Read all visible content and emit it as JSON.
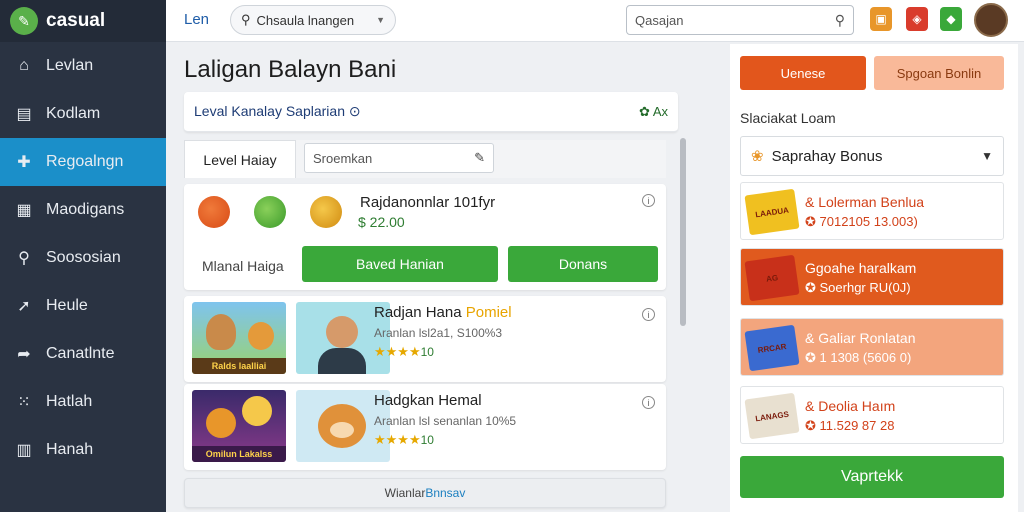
{
  "app": {
    "brand": "casual",
    "logo_glyph": "✎"
  },
  "sidebar": {
    "items": [
      {
        "label": "Levlan",
        "icon": "home-icon",
        "glyph": "⌂",
        "active": false
      },
      {
        "label": "Kodlam",
        "icon": "monitor-icon",
        "glyph": "▤",
        "active": false
      },
      {
        "label": "Regoalngn",
        "icon": "puzzle-icon",
        "glyph": "✚",
        "active": true
      },
      {
        "label": "Maodigans",
        "icon": "dashboard-icon",
        "glyph": "▦",
        "active": false
      },
      {
        "label": "Soososian",
        "icon": "search-icon",
        "glyph": "⚲",
        "active": false
      },
      {
        "label": "Heule",
        "icon": "pin-icon",
        "glyph": "➚",
        "active": false
      },
      {
        "label": "Canatlnte",
        "icon": "share-icon",
        "glyph": "➦",
        "active": false
      },
      {
        "label": "Hatlah",
        "icon": "grid-icon",
        "glyph": "⁙",
        "active": false
      },
      {
        "label": "Hanah",
        "icon": "book-icon",
        "glyph": "▥",
        "active": false
      }
    ]
  },
  "topbar": {
    "lang": "Len",
    "select_label": "Chsaula lnangen",
    "search_placeholder": "Qasajan",
    "icons": [
      {
        "name": "store-icon",
        "color": "#e8962a",
        "glyph": "▣"
      },
      {
        "name": "shield-icon",
        "color": "#d93c2c",
        "glyph": "◈"
      },
      {
        "name": "android-icon",
        "color": "#3aa83a",
        "glyph": "◆"
      }
    ]
  },
  "main": {
    "title": "Laligan Balayn Bani",
    "section": {
      "title": "Leval Kanalay Saplarian ⊙",
      "right": "✿ Ax"
    },
    "tab": {
      "active": "Level Haiay",
      "input_placeholder": "Sroemkan"
    },
    "featured": {
      "title": "Rajdanonnlar 101fyr",
      "price": "$ 22.00",
      "label": "Mlanal Haiga",
      "btn1": "Baved Hanian",
      "btn2": "Donans"
    },
    "games": [
      {
        "title": "Radjan Hana",
        "title_hl": "Pomiel",
        "sub": "Aranlan lsl2a1, S100%3",
        "stars": "★★★★",
        "rating": "10",
        "thumb_caption": "Ralds laalliai"
      },
      {
        "title": "Hadgkan Hemal",
        "title_hl": "",
        "sub": "Aranlan lsl senanlan 10%5",
        "stars": "★★★★",
        "rating": "10",
        "thumb_caption": "Omilun Lakalss"
      }
    ],
    "footer": {
      "text": "Wianlar ",
      "hl": "Bnnsav"
    }
  },
  "right": {
    "btn_primary": "Uenese",
    "btn_secondary": "Spgoan Bonlin",
    "label": "Slaciakat Loam",
    "select_value": "Saprahay Bonus",
    "offers": [
      {
        "title": "& Lolerman Benlua",
        "sub": "✪ 7012105 13.003)",
        "bg": "#ffffff",
        "title_color": "#d2421a",
        "sub_color": "#d2421a",
        "img_text": "LAADUA"
      },
      {
        "title": "Ggoahe haralkam",
        "sub": "✪ Soerhgr RU(0J)",
        "bg": "#e05a1e",
        "title_color": "#ffffff",
        "sub_color": "#ffffff",
        "img_text": "AG"
      },
      {
        "title": "& Galiar Ronlatan",
        "sub": "✪ 1 1308 (5606 0)",
        "bg": "#f3a57d",
        "title_color": "#ffffff",
        "sub_color": "#ffffff",
        "img_text": "RRCAR"
      },
      {
        "title": "& Deolia Haım",
        "sub": "✪ 11.529 87 28",
        "bg": "#ffffff",
        "title_color": "#d2421a",
        "sub_color": "#d2421a",
        "img_text": "LANAGS"
      }
    ],
    "cta": "Vaprtekk"
  },
  "colors": {
    "accent_blue": "#1b8fc9",
    "green": "#3aa83a",
    "orange": "#e05a1e",
    "sidebar_bg": "#2a3342"
  }
}
